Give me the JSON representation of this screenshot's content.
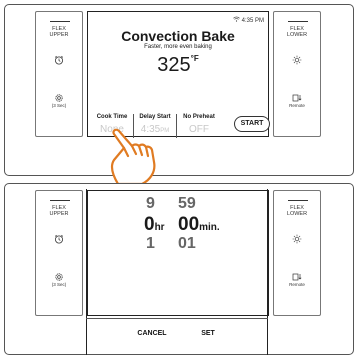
{
  "panel1": {
    "left_side": {
      "line1": "FLEX",
      "line2": "UPPER",
      "timer_icon": "alarm-clock-icon",
      "lock_icon": "gear-lock-icon",
      "lock_label": "(3 Sec)"
    },
    "right_side": {
      "line1": "FLEX",
      "line2": "LOWER",
      "light_icon": "oven-light-icon",
      "remote_icon": "remote-enable-icon",
      "remote_label": "Remote"
    },
    "status": {
      "wifi_icon": "wifi-icon",
      "time": "4:35 PM"
    },
    "title": "Convection Bake",
    "subtitle": "Faster, more even baking",
    "temperature": "325",
    "temp_unit": "°F",
    "options": [
      {
        "label": "Cook Time",
        "value": "None",
        "suffix": ""
      },
      {
        "label": "Delay Start",
        "value": "4:35",
        "suffix": "PM"
      },
      {
        "label": "No Preheat",
        "value": "OFF",
        "suffix": ""
      }
    ],
    "start_label": "START",
    "pointer_icon": "pointing-hand-icon"
  },
  "panel2": {
    "left_side": {
      "line1": "FLEX",
      "line2": "UPPER",
      "timer_icon": "alarm-clock-icon",
      "lock_icon": "gear-lock-icon",
      "lock_label": "(3 Sec)"
    },
    "right_side": {
      "line1": "FLEX",
      "line2": "LOWER",
      "light_icon": "oven-light-icon",
      "remote_icon": "remote-enable-icon",
      "remote_label": "Remote"
    },
    "hours": {
      "above": "9",
      "current": "0",
      "below": "1",
      "unit": "hr"
    },
    "minutes": {
      "above": "59",
      "current": "00",
      "below": "01",
      "unit": "min."
    },
    "cancel_label": "CANCEL",
    "set_label": "SET"
  }
}
